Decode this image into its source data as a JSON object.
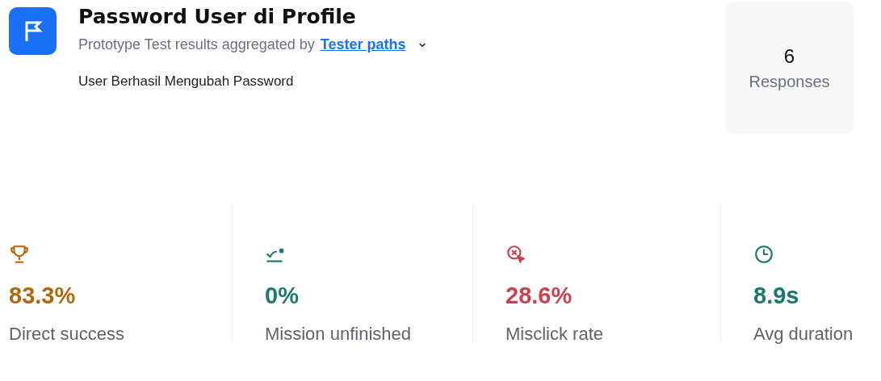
{
  "header": {
    "title": "Password User di Profile",
    "subtitle": "Prototype Test results aggregated by",
    "aggregation_link": "Tester paths",
    "dropdown_icon": "⌄",
    "description": "User Berhasil Mengubah Password"
  },
  "responses": {
    "count": "6",
    "label": "Responses"
  },
  "metrics": [
    {
      "kind": "trophy",
      "value": "83.3%",
      "label": "Direct success",
      "color": "#b2680c"
    },
    {
      "kind": "unfinished",
      "value": "0%",
      "label": "Mission unfinished",
      "color": "#1b7a70"
    },
    {
      "kind": "misclick",
      "value": "28.6%",
      "label": "Misclick rate",
      "color": "#c8424f"
    },
    {
      "kind": "clock",
      "value": "8.9s",
      "label": "Avg duration",
      "color": "#1b7a70"
    }
  ]
}
